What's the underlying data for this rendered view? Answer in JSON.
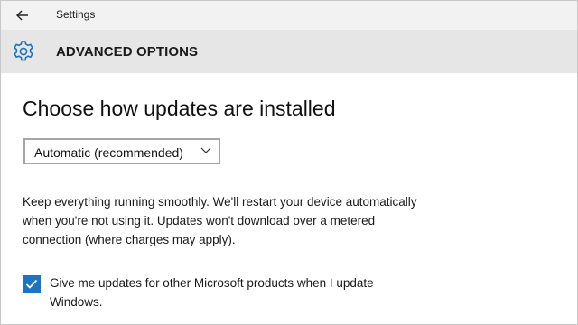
{
  "titlebar": {
    "app_title": "Settings",
    "back_icon": "arrow-left-icon"
  },
  "header": {
    "title": "ADVANCED OPTIONS",
    "icon": "gear-icon",
    "icon_color": "#1e73be"
  },
  "main": {
    "title": "Choose how updates are installed",
    "dropdown": {
      "selected": "Automatic (recommended)",
      "icon": "chevron-down-icon"
    },
    "description": "Keep everything running smoothly. We'll restart your device automatically when you're not using it. Updates won't download over a metered connection (where charges may apply).",
    "checkbox": {
      "checked": true,
      "label": "Give me updates for other Microsoft products when I update Windows.",
      "color": "#1e73be"
    }
  }
}
